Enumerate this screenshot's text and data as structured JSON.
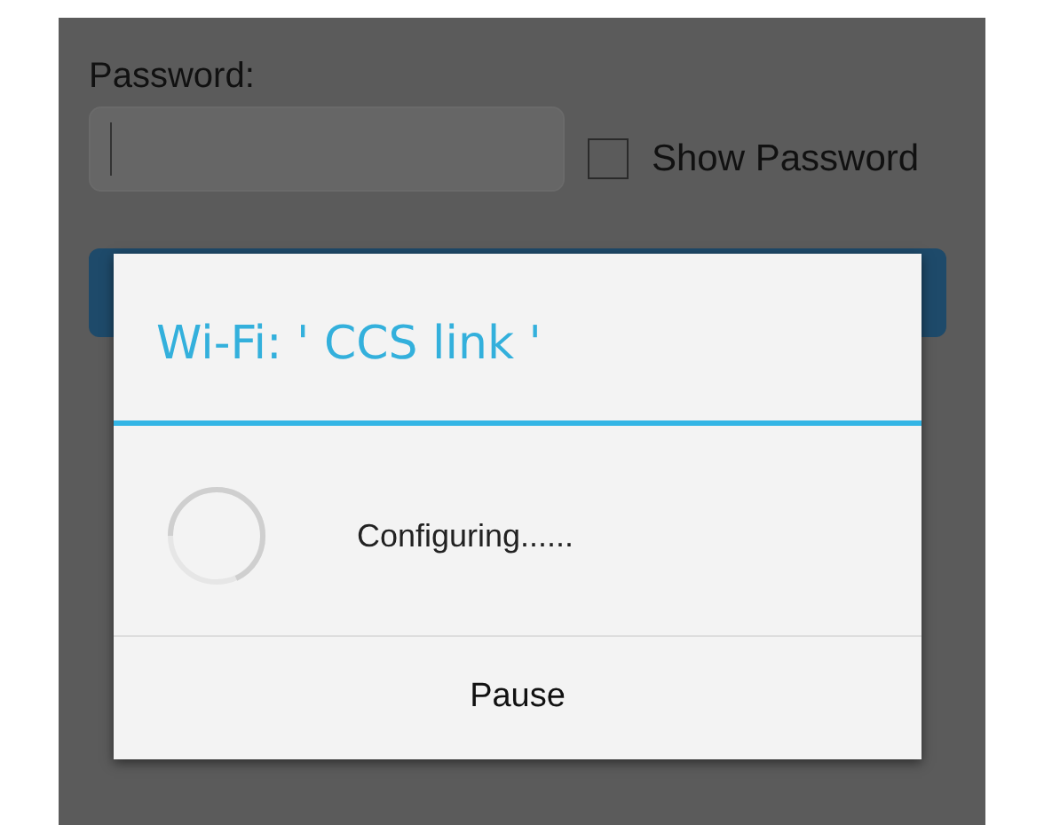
{
  "form": {
    "password_label": "Password:",
    "show_password": {
      "label": "Show Password",
      "checked": false
    }
  },
  "dialog": {
    "title": "Wi-Fi: ' CCS link '",
    "message": "Configuring......",
    "button": "Pause"
  }
}
